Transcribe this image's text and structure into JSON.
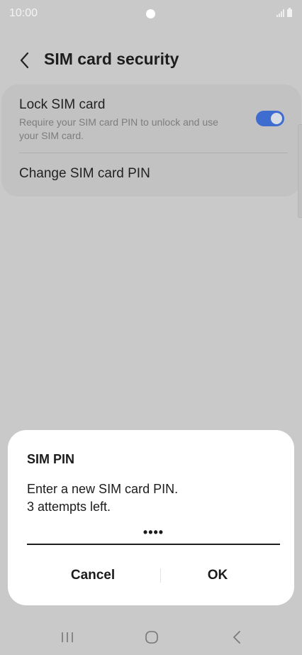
{
  "status_bar": {
    "time": "10:00"
  },
  "header": {
    "title": "SIM card security",
    "back_icon": "chevron-left-icon"
  },
  "settings": {
    "lock_sim": {
      "title": "Lock SIM card",
      "description": "Require your SIM card PIN to unlock and use your SIM card.",
      "enabled": true
    },
    "change_pin": {
      "label": "Change SIM card PIN"
    }
  },
  "dialog": {
    "title": "SIM PIN",
    "message_line1": "Enter a new SIM card PIN.",
    "message_line2": "3 attempts left.",
    "pin_value": "••••",
    "cancel_label": "Cancel",
    "ok_label": "OK"
  },
  "nav_bar": {
    "recent_icon": "recent-apps-icon",
    "home_icon": "home-icon",
    "back_icon": "back-icon"
  },
  "colors": {
    "toggle_on": "#3e6ccf",
    "scrim_background": "#c9c9c9",
    "dialog_background": "#ffffff"
  }
}
